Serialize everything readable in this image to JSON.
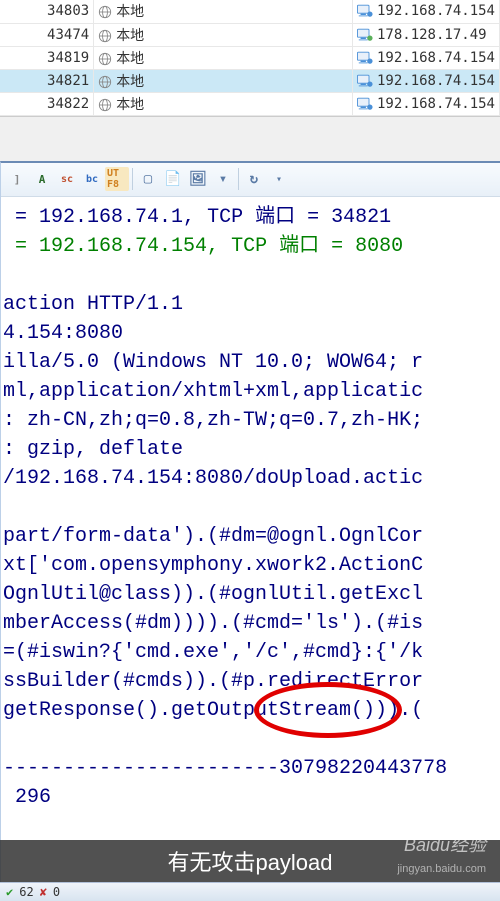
{
  "connections": [
    {
      "port": "34803",
      "host": "本地",
      "ip": "192.168.74.154",
      "selected": false,
      "iconType": "local"
    },
    {
      "port": "43474",
      "host": "本地",
      "ip": "178.128.17.49",
      "selected": false,
      "iconType": "remote"
    },
    {
      "port": "34819",
      "host": "本地",
      "ip": "192.168.74.154",
      "selected": false,
      "iconType": "local"
    },
    {
      "port": "34821",
      "host": "本地",
      "ip": "192.168.74.154",
      "selected": true,
      "iconType": "local"
    },
    {
      "port": "34822",
      "host": "本地",
      "ip": "192.168.74.154",
      "selected": false,
      "iconType": "local"
    }
  ],
  "toolbar": {
    "buttons": [
      "]",
      "A",
      "sc",
      "bc",
      "UT F8"
    ],
    "icons": [
      "box-icon",
      "doc-icon",
      "img-icon",
      "dropdown-icon",
      "refresh-icon"
    ]
  },
  "packet": {
    "src_ip": "192.168.74.1",
    "src_port_label": "TCP 端口",
    "src_port": "34821",
    "dst_ip": "192.168.74.154",
    "dst_port_label": "TCP 端口",
    "dst_port": "8080",
    "lines": [
      "",
      "action HTTP/1.1",
      "4.154:8080",
      "illa/5.0 (Windows NT 10.0; WOW64; r",
      "ml,application/xhtml+xml,applicatic",
      ": zh-CN,zh;q=0.8,zh-TW;q=0.7,zh-HK;",
      ": gzip, deflate",
      "/192.168.74.154:8080/doUpload.actic",
      "",
      "part/form-data').(#dm=@ognl.OgnlCor",
      "xt['com.opensymphony.xwork2.ActionC",
      "OgnlUtil@class)).(#ognlUtil.getExcl",
      "mberAccess(#dm)))).(#cmd='ls').(#is",
      "=(#iswin?{'cmd.exe','/c',#cmd}:{'/k",
      "ssBuilder(#cmds)).(#p.redirectError",
      "getResponse().getOutputStream())).(",
      "",
      "-----------------------30798220443778",
      " 296"
    ]
  },
  "overlay_text": "有无攻击payload",
  "status": {
    "ok_count": "62",
    "err_count": "0"
  },
  "watermark": {
    "line1": "Baidu经验",
    "line2": "jingyan.baidu.com"
  }
}
